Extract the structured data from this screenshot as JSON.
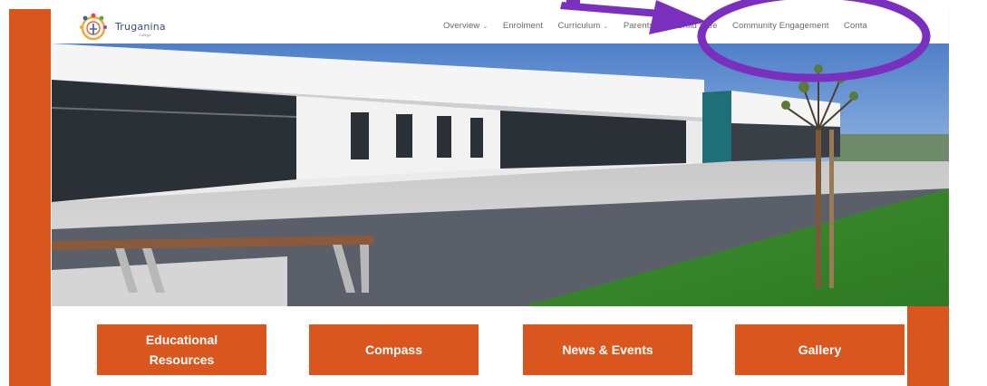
{
  "site": {
    "name": "Truganina",
    "subname": "College"
  },
  "nav": {
    "items": [
      {
        "label": "Overview",
        "has_dropdown": true
      },
      {
        "label": "Enrolment",
        "has_dropdown": false
      },
      {
        "label": "Curriculum",
        "has_dropdown": true
      },
      {
        "label": "Parents",
        "has_dropdown": true
      },
      {
        "label": "Child Safe",
        "has_dropdown": false
      },
      {
        "label": "Community Engagement",
        "has_dropdown": false
      },
      {
        "label": "Conta",
        "has_dropdown": false
      }
    ],
    "chevron": "chevron-down-icon"
  },
  "tiles": [
    {
      "label": "Educational Resources"
    },
    {
      "label": "Compass"
    },
    {
      "label": "News & Events"
    },
    {
      "label": "Gallery"
    }
  ],
  "colors": {
    "brand_orange": "#d9571f",
    "annotation_purple": "#7b2fbe",
    "nav_text": "#6a6a6a"
  }
}
